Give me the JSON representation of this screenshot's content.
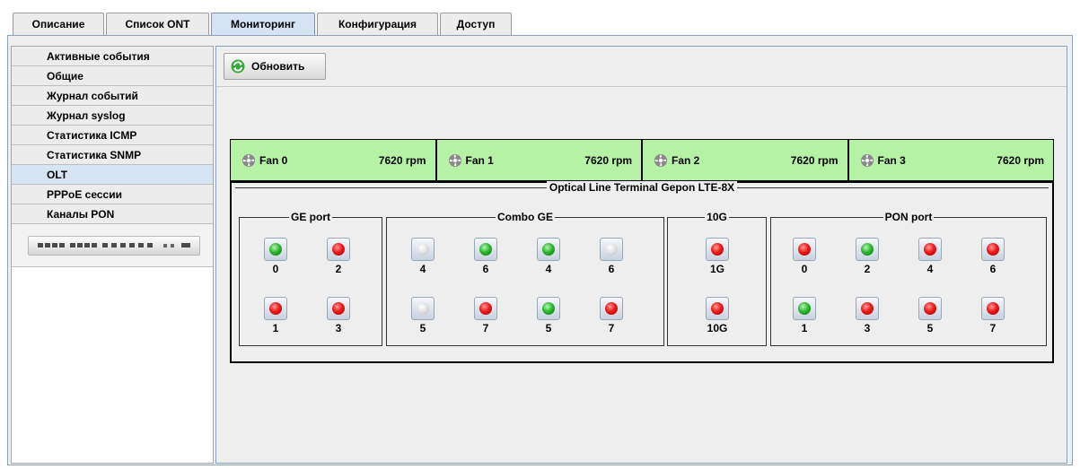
{
  "tabs": [
    {
      "label": "Описание",
      "active": false
    },
    {
      "label": "Список ONT",
      "active": false
    },
    {
      "label": "Мониторинг",
      "active": true
    },
    {
      "label": "Конфигурация",
      "active": false
    },
    {
      "label": "Доступ",
      "active": false
    }
  ],
  "sidebar": {
    "items": [
      {
        "label": "Активные события",
        "active": false
      },
      {
        "label": "Общие",
        "active": false
      },
      {
        "label": "Журнал событий",
        "active": false
      },
      {
        "label": "Журнал syslog",
        "active": false
      },
      {
        "label": "Статистика ICMP",
        "active": false
      },
      {
        "label": "Статистика SNMP",
        "active": false
      },
      {
        "label": "OLT",
        "active": true
      },
      {
        "label": "PPPoE сессии",
        "active": false
      },
      {
        "label": "Каналы PON",
        "active": false
      }
    ],
    "device_image": "olt-device-image"
  },
  "toolbar": {
    "refresh_label": "Обновить",
    "refresh_icon": "refresh-icon"
  },
  "fans": [
    {
      "name": "Fan 0",
      "speed": "7620 rpm"
    },
    {
      "name": "Fan 1",
      "speed": "7620 rpm"
    },
    {
      "name": "Fan 2",
      "speed": "7620 rpm"
    },
    {
      "name": "Fan 3",
      "speed": "7620 rpm"
    }
  ],
  "olt": {
    "title": "Optical Line Terminal Gepon LTE-8X",
    "groups": [
      {
        "title": "GE port",
        "ports": [
          {
            "label": "0",
            "status": "green"
          },
          {
            "label": "2",
            "status": "red"
          },
          {
            "label": "1",
            "status": "red"
          },
          {
            "label": "3",
            "status": "red"
          }
        ]
      },
      {
        "title": "Combo GE",
        "ports": [
          {
            "label": "4",
            "status": "off"
          },
          {
            "label": "6",
            "status": "green"
          },
          {
            "label": "4",
            "status": "green"
          },
          {
            "label": "6",
            "status": "off"
          },
          {
            "label": "5",
            "status": "off"
          },
          {
            "label": "7",
            "status": "red"
          },
          {
            "label": "5",
            "status": "green"
          },
          {
            "label": "7",
            "status": "red"
          }
        ]
      },
      {
        "title": "10G",
        "ports": [
          {
            "label": "1G",
            "status": "red"
          },
          {
            "label": "10G",
            "status": "red"
          }
        ]
      },
      {
        "title": "PON port",
        "ports": [
          {
            "label": "0",
            "status": "red"
          },
          {
            "label": "2",
            "status": "green"
          },
          {
            "label": "4",
            "status": "red"
          },
          {
            "label": "6",
            "status": "red"
          },
          {
            "label": "1",
            "status": "green"
          },
          {
            "label": "3",
            "status": "red"
          },
          {
            "label": "5",
            "status": "red"
          },
          {
            "label": "7",
            "status": "red"
          }
        ]
      }
    ]
  },
  "colors": {
    "fan_bg": "#b6f2a6",
    "active_tab_bg": "#d6e3f2",
    "led_red": "#ee1a1a",
    "led_green": "#2fb82f",
    "led_off": "#dcdcdc"
  }
}
